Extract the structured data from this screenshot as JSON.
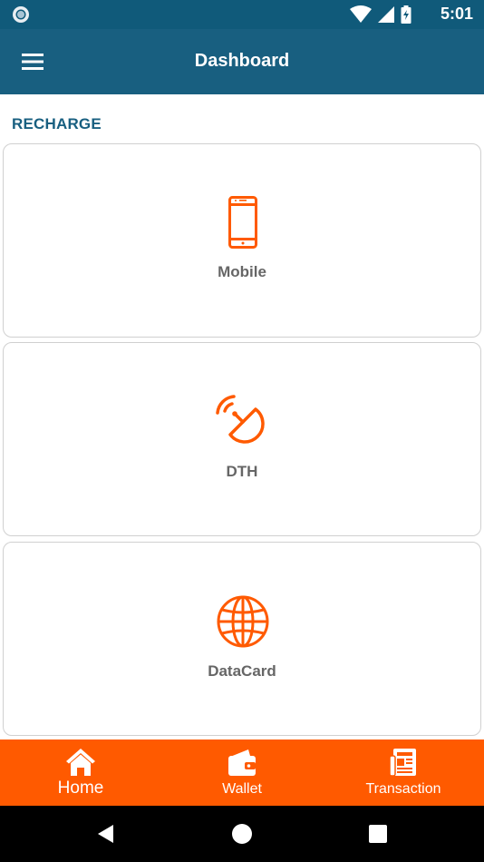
{
  "status_bar": {
    "time": "5:01",
    "icons": [
      "notification-circle-icon",
      "wifi-icon",
      "cellular-signal-icon",
      "battery-charging-icon"
    ]
  },
  "app_bar": {
    "title": "Dashboard",
    "menu_icon": "hamburger-menu-icon"
  },
  "section": {
    "title": "RECHARGE"
  },
  "cards": [
    {
      "label": "Mobile",
      "icon": "mobile-phone-icon"
    },
    {
      "label": "DTH",
      "icon": "satellite-dish-icon"
    },
    {
      "label": "DataCard",
      "icon": "globe-icon"
    }
  ],
  "bottom_nav": {
    "items": [
      {
        "label": "Home",
        "icon": "home-icon",
        "active": true
      },
      {
        "label": "Wallet",
        "icon": "wallet-icon",
        "active": false
      },
      {
        "label": "Transaction",
        "icon": "receipt-icon",
        "active": false
      }
    ]
  },
  "colors": {
    "primary": "#185f80",
    "status_bar": "#105a7a",
    "accent": "#ff5a00",
    "card_label": "#666666",
    "card_border": "#d0d0d0"
  }
}
